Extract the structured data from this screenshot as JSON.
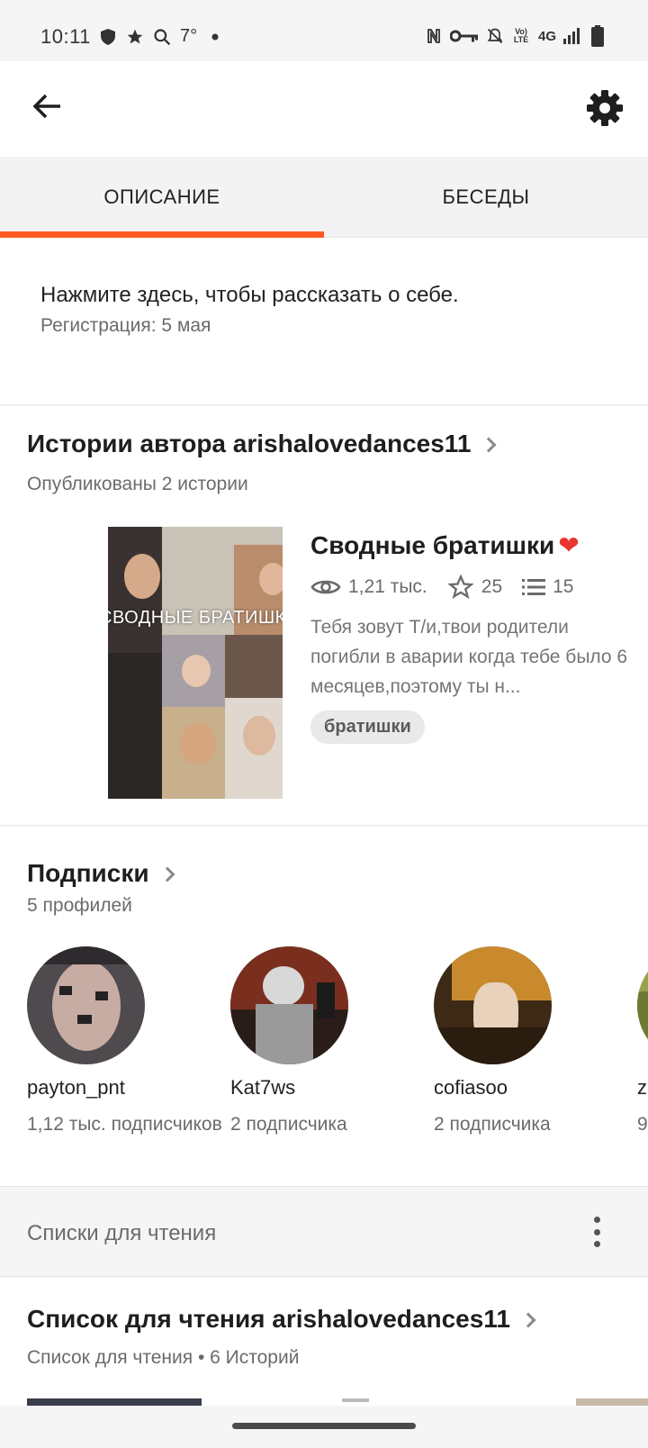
{
  "status_bar": {
    "time": "10:11",
    "temperature": "7°",
    "network": "4G",
    "icons_left": [
      "shield-icon",
      "star-icon",
      "search-icon",
      "dot-icon"
    ],
    "icons_right": [
      "nfc-icon",
      "key-icon",
      "bell-off-icon",
      "volte-icon",
      "signal-icon",
      "battery-icon"
    ]
  },
  "app_bar": {
    "back_icon": "arrow-left-icon",
    "settings_icon": "gear-icon"
  },
  "tabs": [
    {
      "label": "ОПИСАНИЕ",
      "active": true
    },
    {
      "label": "БЕСЕДЫ",
      "active": false
    }
  ],
  "accent_color": "#ff5a1f",
  "about": {
    "prompt": "Нажмите здесь, чтобы рассказать о себе.",
    "registration": "Регистрация: 5 мая"
  },
  "stories_section": {
    "title": "Истории автора arishalovedances11",
    "subtitle": "Опубликованы 2 истории",
    "story": {
      "cover_text": "СВОДНЫЕ БРАТИШКИ",
      "title": "Сводные братишки",
      "title_emoji": "❤️",
      "views": "1,21 тыс.",
      "votes": "25",
      "parts": "15",
      "description": "Тебя зовут Т/и,твои родители погибли в аварии когда тебе было 6 месяцев,поэтому ты н...",
      "tag": "братишки"
    }
  },
  "following_section": {
    "title": "Подписки",
    "subtitle": "5 профилей",
    "profiles": [
      {
        "name": "payton_pnt",
        "followers": "1,12 тыс. подписчиков"
      },
      {
        "name": "Kat7ws",
        "followers": "2 подписчика"
      },
      {
        "name": "cofiasoo",
        "followers": "2 подписчика"
      },
      {
        "name": "z",
        "followers": "9"
      }
    ]
  },
  "reading_lists_bar": {
    "label": "Списки для чтения",
    "more_icon": "more-vertical-icon"
  },
  "reading_list": {
    "title": "Список для чтения arishalovedances11",
    "subtitle": "Список для чтения • 6 Историй"
  }
}
